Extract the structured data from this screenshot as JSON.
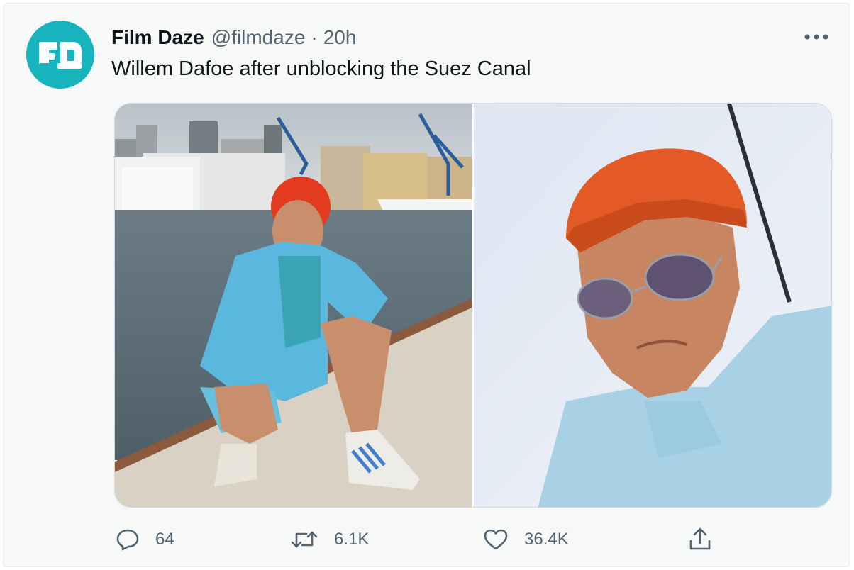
{
  "tweet": {
    "author_name": "Film Daze",
    "author_handle": "@filmdaze",
    "separator": "·",
    "time": "20h",
    "text": "Willem Dafoe after unblocking the Suez Canal",
    "avatar_icon": "film-daze-logo",
    "avatar_color": "#17b4be",
    "more_icon": "more-horizontal-icon",
    "media": [
      {
        "name": "photo-left",
        "description_icon": "image"
      },
      {
        "name": "photo-right",
        "description_icon": "image"
      }
    ],
    "actions": {
      "reply": {
        "icon": "reply-icon",
        "count": "64"
      },
      "retweet": {
        "icon": "retweet-icon",
        "count": "6.1K"
      },
      "like": {
        "icon": "heart-icon",
        "count": "36.4K"
      },
      "share": {
        "icon": "share-icon"
      }
    }
  },
  "colors": {
    "background": "#f7f9f9",
    "text_primary": "#0f1419",
    "text_secondary": "#536471",
    "border": "#cfd9de"
  }
}
